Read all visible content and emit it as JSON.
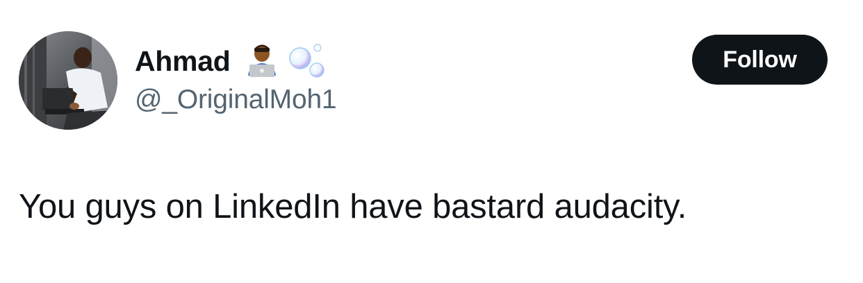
{
  "author": {
    "display_name": "Ahmad",
    "handle": "@_OriginalMoh1",
    "name_emojis": [
      "man-technologist-emoji",
      "bubbles-emoji"
    ]
  },
  "follow_button": {
    "label": "Follow"
  },
  "tweet": {
    "text": "You guys on LinkedIn have bastard audacity."
  },
  "colors": {
    "text_primary": "#0f1419",
    "text_secondary": "#536471",
    "button_bg": "#0f1419",
    "button_text": "#ffffff",
    "background": "#ffffff"
  }
}
